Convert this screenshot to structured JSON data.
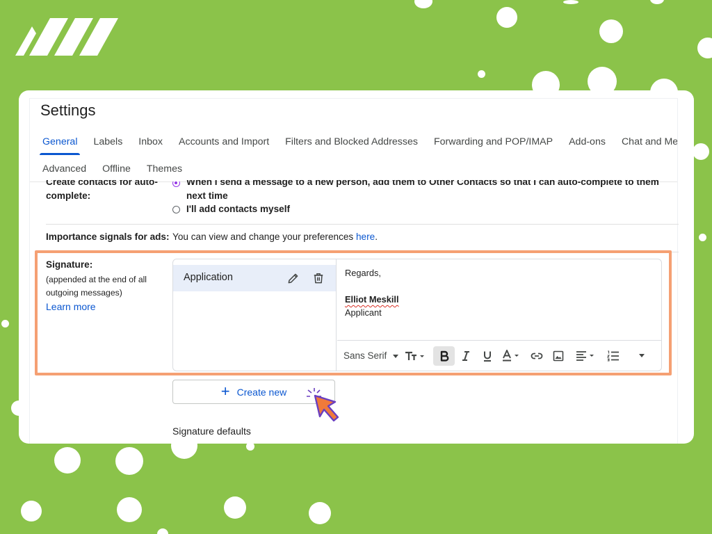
{
  "settings": {
    "title": "Settings",
    "tabs_row1": [
      "General",
      "Labels",
      "Inbox",
      "Accounts and Import",
      "Filters and Blocked Addresses",
      "Forwarding and POP/IMAP",
      "Add-ons",
      "Chat and Meet"
    ],
    "tabs_row2": [
      "Advanced",
      "Offline",
      "Themes"
    ],
    "active_tab": "General"
  },
  "create_contacts": {
    "label_line1": "Create contacts for auto-",
    "label_line2": "complete:",
    "option1_line1": "When I send a message to a new person, add them to Other Contacts so that I can auto-complete to them",
    "option1_line2": "next time",
    "option2": "I'll add contacts myself",
    "selected": "option1"
  },
  "importance": {
    "label": "Importance signals for ads:",
    "text": "You can view and change your preferences ",
    "link": "here",
    "period": "."
  },
  "signature": {
    "label": "Signature:",
    "desc_line1": "(appended at the end of all",
    "desc_line2": "outgoing messages)",
    "learn_more": "Learn more",
    "item_name": "Application",
    "body_line1": "Regards,",
    "body_name": "Elliot Meskill",
    "body_role": "Applicant",
    "font_select": "Sans Serif",
    "create_new": "Create new",
    "defaults_heading": "Signature defaults"
  },
  "toolbar_icons": [
    "text-size-icon",
    "bold-icon",
    "italic-icon",
    "underline-icon",
    "text-color-icon",
    "link-icon",
    "image-icon",
    "align-icon",
    "numbered-list-icon",
    "more-formatting-icon"
  ],
  "colors": {
    "background": "#8bc34a",
    "accent": "#0b57d0",
    "highlight": "#f5a073",
    "radio_selected": "#9334e6"
  }
}
